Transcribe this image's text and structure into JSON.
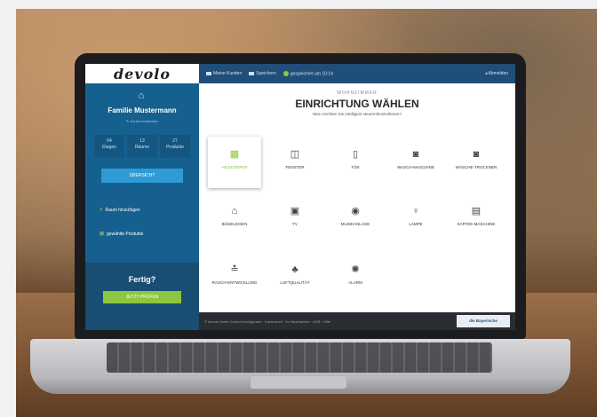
{
  "app": {
    "logo": "devolo"
  },
  "topbar": {
    "my_customers": "Meine Kunden",
    "save": "Speichern",
    "saved_status": "gespeichert um 10:14",
    "logout": "Abmelden"
  },
  "sidebar": {
    "family_name": "Familie Mustermann",
    "edit": "Kunde bearbeiten",
    "stats": [
      {
        "value": "04",
        "label": "Etagen"
      },
      {
        "value": "13",
        "label": "Räume"
      },
      {
        "value": "27",
        "label": "Produkte"
      }
    ],
    "overview_button": "ÜBERSICHT",
    "add_room": "Raum hinzufügen",
    "selected_products": "gewählte Produkte",
    "done_heading": "Fertig?",
    "test_button": "JETZT PRÜFEN"
  },
  "main": {
    "room": "WOHNZIMMER",
    "title": "EINRICHTUNG WÄHLEN",
    "question": "Was möchten Sie intelligent steuern/kontrollieren?",
    "tiles": [
      {
        "label": "HEIZKÖRPER",
        "icon": "radiator-icon",
        "glyph": "▦",
        "active": true
      },
      {
        "label": "FENSTER",
        "icon": "window-icon",
        "glyph": "◫",
        "active": false
      },
      {
        "label": "TÜR",
        "icon": "door-icon",
        "glyph": "▯",
        "active": false
      },
      {
        "label": "WASCH-MASCHINE",
        "icon": "washing-machine-icon",
        "glyph": "◙",
        "active": false
      },
      {
        "label": "WÄSCHE-TROCKNER",
        "icon": "dryer-icon",
        "glyph": "◙",
        "active": false
      },
      {
        "label": "BÜGELEISEN",
        "icon": "iron-icon",
        "glyph": "⌂",
        "active": false
      },
      {
        "label": "TV",
        "icon": "tv-icon",
        "glyph": "▣",
        "active": false
      },
      {
        "label": "MUSIKANLAGE",
        "icon": "speaker-icon",
        "glyph": "◉",
        "active": false
      },
      {
        "label": "LAMPE",
        "icon": "lamp-icon",
        "glyph": "♀",
        "active": false
      },
      {
        "label": "KAFFEE-MASCHINE",
        "icon": "coffee-machine-icon",
        "glyph": "▤",
        "active": false
      },
      {
        "label": "RAUCH-ENTWICKLUNG",
        "icon": "smoke-icon",
        "glyph": "≛",
        "active": false
      },
      {
        "label": "LUFTQUALITÄT",
        "icon": "air-quality-icon",
        "glyph": "♣",
        "active": false
      },
      {
        "label": "ALARM",
        "icon": "alarm-icon",
        "glyph": "✺",
        "active": false
      }
    ]
  },
  "footer": {
    "text": "© devolo Home Control Konfigurator   ·   Impressum   ·   Ihr Beantworter   ·   AGB   ·   Hilfe",
    "brand": "die Bayerische"
  }
}
